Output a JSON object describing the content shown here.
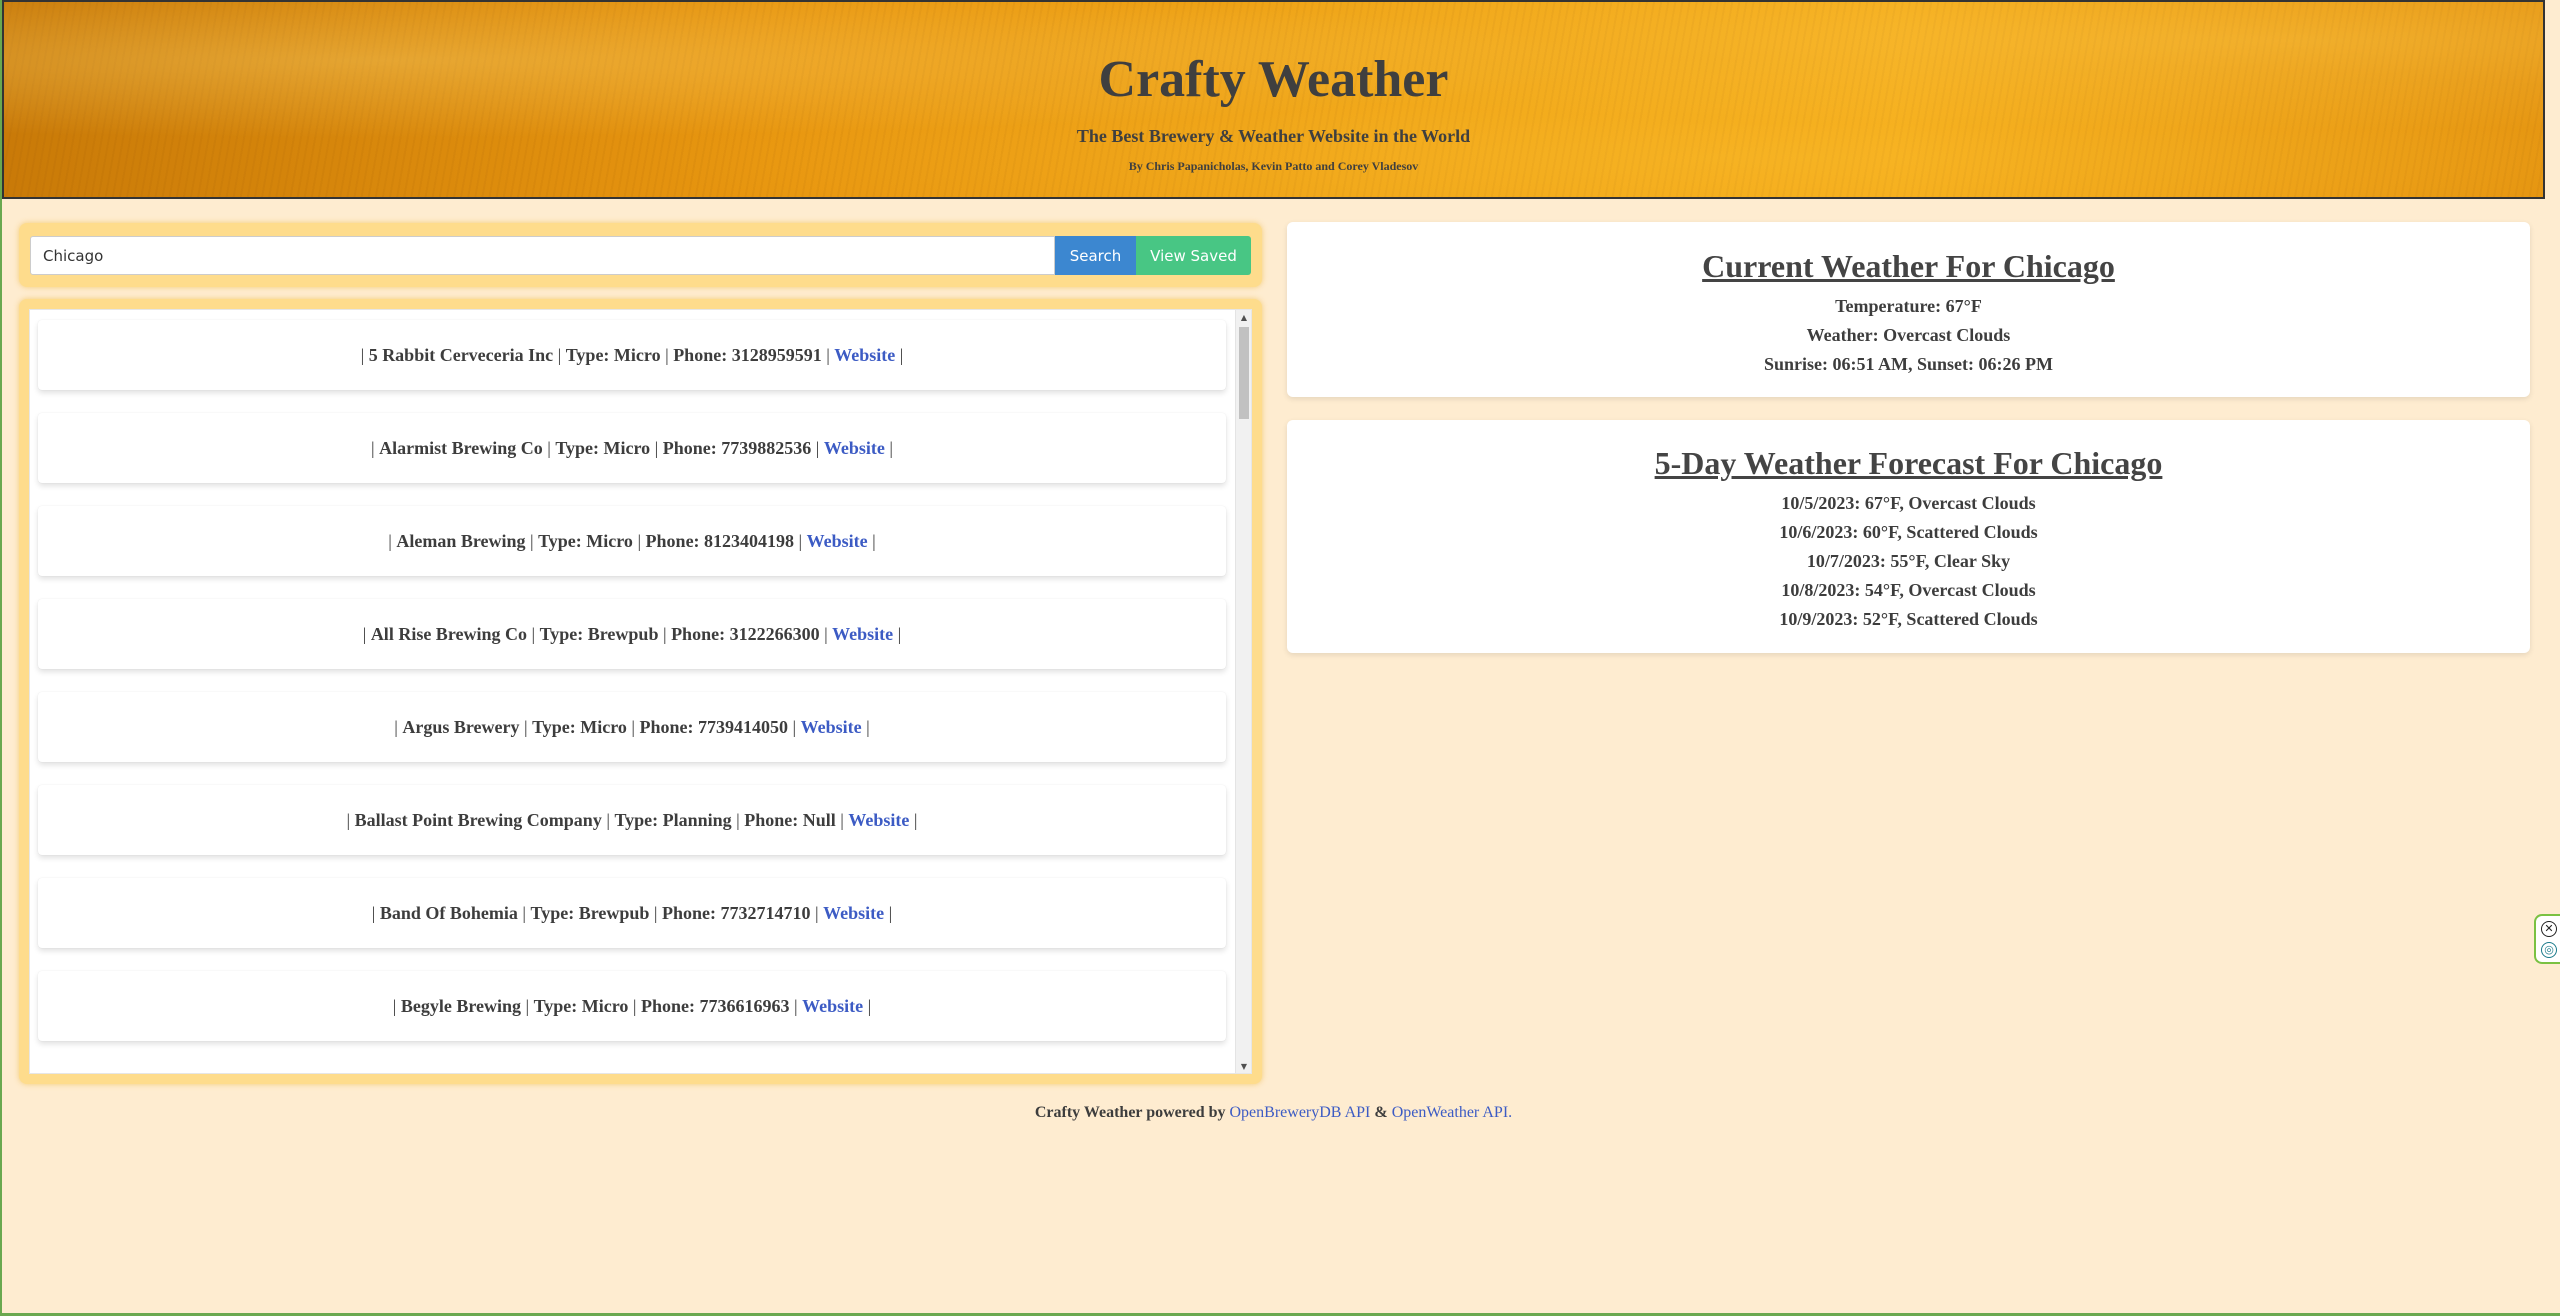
{
  "header": {
    "title": "Crafty Weather",
    "subtitle": "The Best Brewery & Weather Website in the World",
    "credits": "By Chris Papanicholas, Kevin Patto and Corey Vladesov"
  },
  "search": {
    "value": "Chicago",
    "search_label": "Search",
    "saved_label": "View Saved"
  },
  "breweries": [
    {
      "name": "5 Rabbit Cerveceria Inc",
      "type": "Type: Micro",
      "phone": "Phone: 3128959591",
      "link": "Website"
    },
    {
      "name": "Alarmist Brewing Co",
      "type": "Type: Micro",
      "phone": "Phone: 7739882536",
      "link": "Website"
    },
    {
      "name": "Aleman Brewing",
      "type": "Type: Micro",
      "phone": "Phone: 8123404198",
      "link": "Website"
    },
    {
      "name": "All Rise Brewing Co",
      "type": "Type: Brewpub",
      "phone": "Phone: 3122266300",
      "link": "Website"
    },
    {
      "name": "Argus Brewery",
      "type": "Type: Micro",
      "phone": "Phone: 7739414050",
      "link": "Website"
    },
    {
      "name": "Ballast Point Brewing Company",
      "type": "Type: Planning",
      "phone": "Phone: Null",
      "link": "Website"
    },
    {
      "name": "Band Of Bohemia",
      "type": "Type: Brewpub",
      "phone": "Phone: 7732714710",
      "link": "Website"
    },
    {
      "name": "Begyle Brewing",
      "type": "Type: Micro",
      "phone": "Phone: 7736616963",
      "link": "Website"
    }
  ],
  "current_weather": {
    "heading": "Current Weather For Chicago",
    "temperature": "Temperature: 67°F",
    "weather": "Weather: Overcast Clouds",
    "sun": "Sunrise: 06:51 AM, Sunset: 06:26 PM"
  },
  "forecast": {
    "heading": "5-Day Weather Forecast For Chicago",
    "days": [
      "10/5/2023: 67°F, Overcast Clouds",
      "10/6/2023: 60°F, Scattered Clouds",
      "10/7/2023: 55°F, Clear Sky",
      "10/8/2023: 54°F, Overcast Clouds",
      "10/9/2023: 52°F, Scattered Clouds"
    ]
  },
  "footer": {
    "prefix": "Crafty Weather powered by",
    "link1": "OpenBreweryDB API",
    "amp": "&",
    "link2": "OpenWeather API."
  },
  "scrollbar": {
    "up_icon": "▲",
    "down_icon": "▼"
  },
  "widget": {
    "close_icon": "✕",
    "target_icon": "◎"
  }
}
